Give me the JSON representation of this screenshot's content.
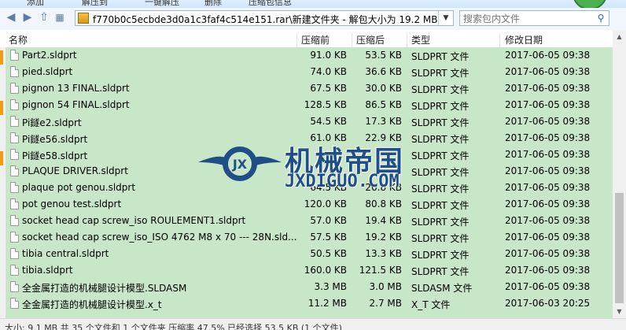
{
  "toolbar": {
    "items": [
      "添加",
      "解压到",
      "一键解压",
      "删除",
      "压缩包信息"
    ]
  },
  "nav": {
    "address": "f770b0c5ecbde3d0a1c3faf4c514e151.rar\\新建文件夹 - 解包大小为 19.2 MB",
    "search_placeholder": "搜索包内文件"
  },
  "columns": {
    "name": "名称",
    "packed": "压缩前",
    "size": "压缩后",
    "type": "类型",
    "date": "修改日期"
  },
  "files": [
    {
      "name": "Part2.sldprt",
      "packed": "91.0 KB",
      "size": "53.5 KB",
      "type": "SLDPRT 文件",
      "date": "2017-06-05 09:38"
    },
    {
      "name": "pied.sldprt",
      "packed": "74.0 KB",
      "size": "36.6 KB",
      "type": "SLDPRT 文件",
      "date": "2017-06-05 09:38"
    },
    {
      "name": "pignon 13 FINAL.sldprt",
      "packed": "67.5 KB",
      "size": "30.0 KB",
      "type": "SLDPRT 文件",
      "date": "2017-06-05 09:38"
    },
    {
      "name": "pignon 54 FINAL.sldprt",
      "packed": "128.5 KB",
      "size": "86.5 KB",
      "type": "SLDPRT 文件",
      "date": "2017-06-05 09:38"
    },
    {
      "name": "Pi鐩e2.sldprt",
      "packed": "54.5 KB",
      "size": "17.3 KB",
      "type": "SLDPRT 文件",
      "date": "2017-06-05 09:38"
    },
    {
      "name": "Pi鐩e56.sldprt",
      "packed": "61.0 KB",
      "size": "22.9 KB",
      "type": "SLDPRT 文件",
      "date": "2017-06-05 09:38"
    },
    {
      "name": "Pi鐩e58.sldprt",
      "packed": "",
      "size": "",
      "type": "SLDPRT 文件",
      "date": "2017-06-05 09:38"
    },
    {
      "name": "PLAQUE DRIVER.sldprt",
      "packed": "",
      "size": "",
      "type": "SLDPRT 文件",
      "date": "2017-06-05 09:38"
    },
    {
      "name": "plaque pot genou.sldprt",
      "packed": "64.5 KB",
      "size": "26.8 KB",
      "type": "SLDPRT 文件",
      "date": "2017-06-05 09:38"
    },
    {
      "name": "pot genou test.sldprt",
      "packed": "120.0 KB",
      "size": "80.8 KB",
      "type": "SLDPRT 文件",
      "date": "2017-06-05 09:38"
    },
    {
      "name": "socket head cap screw_iso ROULEMENT1.sldprt",
      "packed": "57.0 KB",
      "size": "19.4 KB",
      "type": "SLDPRT 文件",
      "date": "2017-06-05 09:38"
    },
    {
      "name": "socket head cap screw_iso_ISO 4762 M8 x 70 --- 28N.sld...",
      "packed": "57.5 KB",
      "size": "19.2 KB",
      "type": "SLDPRT 文件",
      "date": "2017-06-05 09:38"
    },
    {
      "name": "tibia central.sldprt",
      "packed": "50.5 KB",
      "size": "13.3 KB",
      "type": "SLDPRT 文件",
      "date": "2017-06-05 09:38"
    },
    {
      "name": "tibia.sldprt",
      "packed": "160.0 KB",
      "size": "121.5 KB",
      "type": "SLDPRT 文件",
      "date": "2017-06-05 09:38"
    },
    {
      "name": "全金属打造的机械腿设计模型.SLDASM",
      "packed": "3.3 MB",
      "size": "3.0 MB",
      "type": "SLDASM 文件",
      "date": "2017-06-05 09:38"
    },
    {
      "name": "全金属打造的机械腿设计模型.x_t",
      "packed": "11.2 MB",
      "size": "2.7 MB",
      "type": "X_T 文件",
      "date": "2017-06-03 20:25"
    }
  ],
  "status": "大小: 9.1 MB 共 35 个文件和 1 个文件夹 压缩率 47.5% 已经选择 53.5 KB (1 个文件)",
  "watermark": {
    "logo_text": "JX",
    "title": "机械帝国",
    "url": "JXDIGUO.COM"
  },
  "colors": {
    "row_bg": "#c8e6c8",
    "accent": "#1a62b6"
  }
}
